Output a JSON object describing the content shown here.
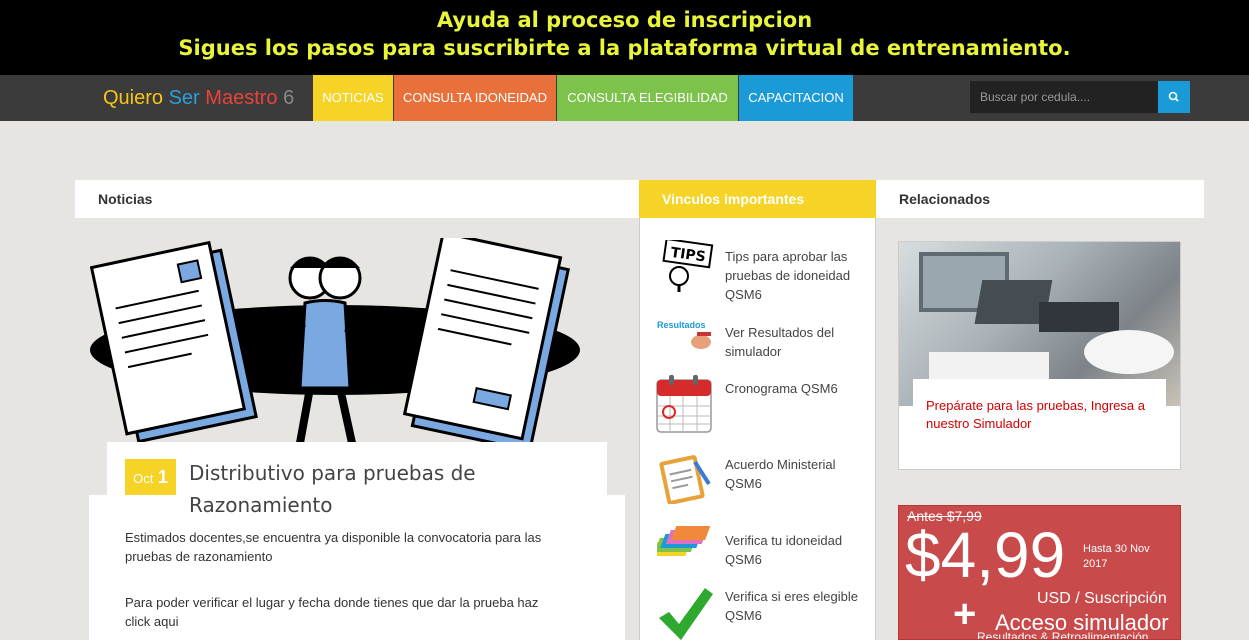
{
  "banner": {
    "line1": "Ayuda al proceso de inscripcion",
    "line2": "Sigues los pasos para suscribirte a la plataforma virtual de entrenamiento."
  },
  "brand": {
    "w1": "Quiero",
    "w2": "Ser",
    "w3": "Maestro",
    "w4": "6",
    "colors": [
      "#f5c518",
      "#2a9fd8",
      "#e8433b",
      "#888888"
    ]
  },
  "nav": {
    "items": [
      {
        "label": "NOTICIAS",
        "color": "#f5d327"
      },
      {
        "label": "CONSULTA IDONEIDAD",
        "color": "#e8703a"
      },
      {
        "label": "CONSULTA ELEGIBILIDAD",
        "color": "#7cc24b"
      },
      {
        "label": "CAPACITACION",
        "color": "#1a9ad6"
      }
    ],
    "search_placeholder": "Buscar por cedula....",
    "search_icon": "search-icon"
  },
  "noticias": {
    "heading": "Noticias",
    "article": {
      "month": "Oct",
      "day": "1",
      "title": "Distributivo para pruebas de Razonamiento",
      "p1": "Estimados docentes,se encuentra ya disponible la convocatoria para las pruebas de razonamiento",
      "p2": "Para poder verificar el lugar y fecha donde tienes que dar la prueba haz click aqui"
    }
  },
  "vinculos": {
    "heading": "Vinculos importantes",
    "items": [
      {
        "label": "Tips para aprobar las pruebas de idoneidad QSM6",
        "icon": "tips-icon"
      },
      {
        "label": "Ver Resultados del simulador",
        "icon": "resultados-icon",
        "icon_text": "Resultados"
      },
      {
        "label": "Cronograma QSM6",
        "icon": "calendar-icon"
      },
      {
        "label": "Acuerdo Ministerial QSM6",
        "icon": "clipboard-icon"
      },
      {
        "label": "Verifica tu idoneidad QSM6",
        "icon": "folders-icon"
      },
      {
        "label": "Verifica si eres elegible QSM6",
        "icon": "checkmark-icon"
      }
    ]
  },
  "relacionados": {
    "heading": "Relacionados",
    "card_caption": "Prepárate para las pruebas, Ingresa a nuestro Simulador",
    "promo": {
      "old_price": "Antes $7,99",
      "price": "$4,99",
      "until": "Hasta 30 Nov 2017",
      "unit": "USD / Suscripción",
      "plus": "+",
      "access": "Acceso simulador",
      "results": "Resultados & Retroalimentación"
    }
  }
}
